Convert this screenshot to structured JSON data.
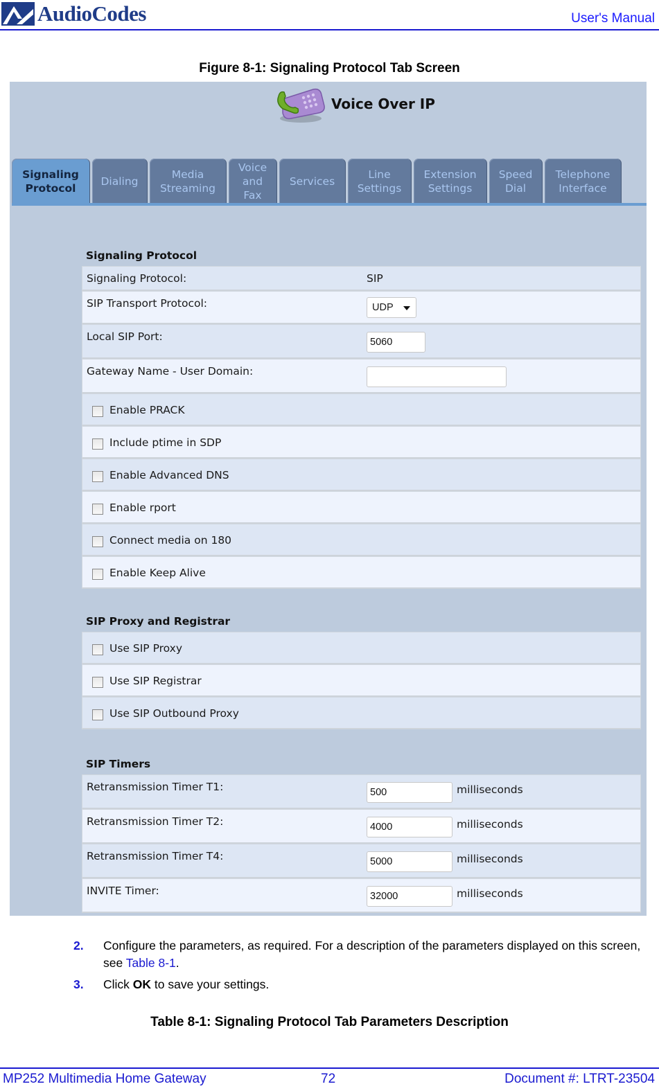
{
  "header": {
    "brand": "AudioCodes",
    "manual_label": "User's Manual"
  },
  "figure": {
    "title": "Figure 8-1: Signaling Protocol Tab Screen"
  },
  "screen": {
    "title": "Voice Over IP",
    "tabs": [
      {
        "label": "Signaling Protocol",
        "lines": [
          "Signaling",
          "Protocol"
        ],
        "active": true
      },
      {
        "label": "Dialing",
        "lines": [
          "Dialing"
        ],
        "active": false
      },
      {
        "label": "Media Streaming",
        "lines": [
          "Media",
          "Streaming"
        ],
        "active": false
      },
      {
        "label": "Voice and Fax",
        "lines": [
          "Voice",
          "and",
          "Fax"
        ],
        "active": false
      },
      {
        "label": "Services",
        "lines": [
          "Services"
        ],
        "active": false
      },
      {
        "label": "Line Settings",
        "lines": [
          "Line",
          "Settings"
        ],
        "active": false
      },
      {
        "label": "Extension Settings",
        "lines": [
          "Extension",
          "Settings"
        ],
        "active": false
      },
      {
        "label": "Speed Dial",
        "lines": [
          "Speed",
          "Dial"
        ],
        "active": false
      },
      {
        "label": "Telephone Interface",
        "lines": [
          "Telephone",
          "Interface"
        ],
        "active": false
      }
    ],
    "signaling": {
      "heading": "Signaling Protocol",
      "protocol_label": "Signaling Protocol:",
      "protocol_value": "SIP",
      "transport_label": "SIP Transport Protocol:",
      "transport_value": "UDP",
      "port_label": "Local SIP Port:",
      "port_value": "5060",
      "domain_label": "Gateway Name - User Domain:",
      "domain_value": "",
      "checkboxes": [
        {
          "label": "Enable PRACK",
          "checked": false
        },
        {
          "label": "Include ptime in SDP",
          "checked": false
        },
        {
          "label": "Enable Advanced DNS",
          "checked": false
        },
        {
          "label": "Enable rport",
          "checked": false
        },
        {
          "label": "Connect media on 180",
          "checked": false
        },
        {
          "label": "Enable Keep Alive",
          "checked": false
        }
      ]
    },
    "proxy": {
      "heading": "SIP Proxy and Registrar",
      "checkboxes": [
        {
          "label": "Use SIP Proxy",
          "checked": false
        },
        {
          "label": "Use SIP Registrar",
          "checked": false
        },
        {
          "label": "Use SIP Outbound Proxy",
          "checked": false
        }
      ]
    },
    "timers": {
      "heading": "SIP Timers",
      "unit": "milliseconds",
      "rows": [
        {
          "label": "Retransmission Timer T1:",
          "value": "500"
        },
        {
          "label": "Retransmission Timer T2:",
          "value": "4000"
        },
        {
          "label": "Retransmission Timer T4:",
          "value": "5000"
        },
        {
          "label": "INVITE Timer:",
          "value": "32000"
        }
      ]
    }
  },
  "steps": [
    {
      "num": "2.",
      "text_before": "Configure the parameters, as required. For a description of the parameters displayed on this screen, see ",
      "link": "Table 8-1",
      "text_after": "."
    },
    {
      "num": "3.",
      "text_before": "Click ",
      "bold": "OK",
      "text_after": " to save your settings."
    }
  ],
  "table_title": "Table 8-1: Signaling Protocol Tab Parameters Description",
  "footer": {
    "product": "MP252 Multimedia Home Gateway",
    "page": "72",
    "document": "Document #: LTRT-23504"
  },
  "colors": {
    "brand_blue": "#1f3c88",
    "link_blue": "#1a1ad0",
    "panel_bg": "#bdcbdd",
    "tab_active": "#6a9dd1",
    "tab_inactive": "#637a9d"
  }
}
